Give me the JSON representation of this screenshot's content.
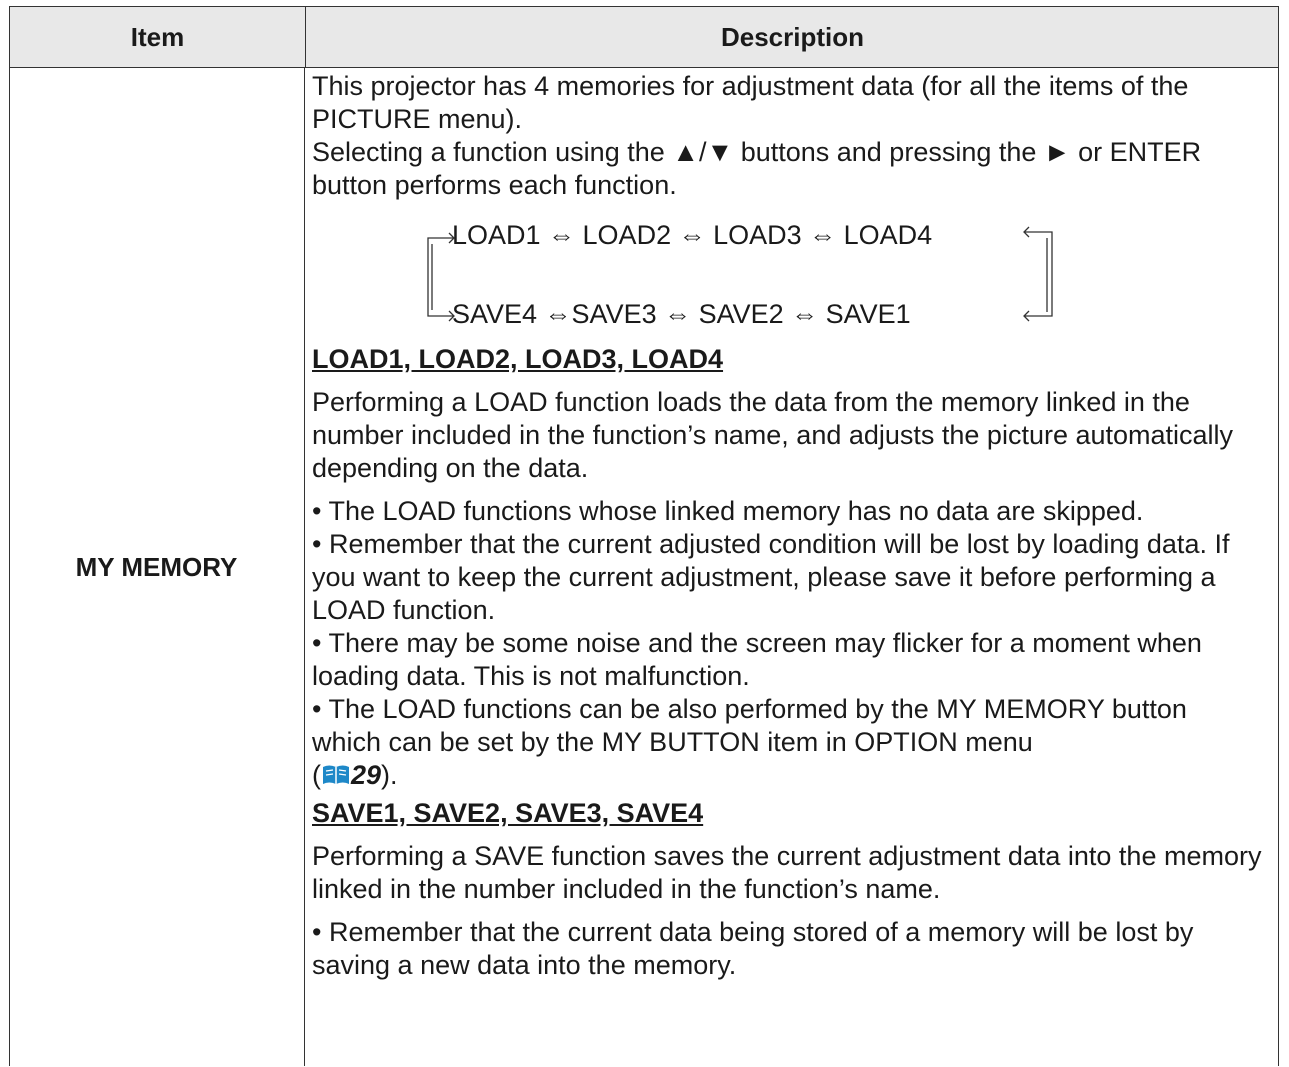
{
  "header": {
    "item": "Item",
    "description": "Description"
  },
  "row": {
    "item": "MY MEMORY",
    "intro_1": "This projector has 4 memories for adjustment data (for all the items of the PICTURE menu).",
    "intro_2": "Selecting a function using the ▲/▼ buttons and pressing the ► or ENTER button performs each function.",
    "flow_top": "LOAD1 ⇔ LOAD2 ⇔ LOAD3 ⇔ LOAD4",
    "flow_bottom": "SAVE4 ⇔SAVE3 ⇔ SAVE2 ⇔ SAVE1",
    "load_heading": "LOAD1, LOAD2, LOAD3, LOAD4",
    "load_desc": "Performing a LOAD function loads the data from the memory linked in the number included in the function’s name, and adjusts the picture automatically depending on the data.",
    "load_note_1": "• The LOAD functions whose linked memory has no data are skipped.",
    "load_note_2": "• Remember that the current adjusted condition will be lost by loading data. If you want to keep the current adjustment, please save it before performing a LOAD function.",
    "load_note_3": "• There may be some noise and the screen may flicker for a moment when loading data. This is not malfunction.",
    "load_note_4": "• The LOAD functions can be also performed by the MY MEMORY button which can be set by the MY BUTTON item in OPTION menu",
    "ref_page": "29",
    "save_heading": "SAVE1, SAVE2, SAVE3, SAVE4",
    "save_desc": "Performing a SAVE function saves the current adjustment data into the memory linked in the number included in the function’s name.",
    "save_note_1": "• Remember that the current data being stored of a memory will be lost by saving a new data into the memory."
  },
  "colors": {
    "header_bg": "#e8e8e8",
    "border": "#333333",
    "ref_icon": "#1e88c8"
  },
  "icons": {
    "reference": "book-icon"
  }
}
